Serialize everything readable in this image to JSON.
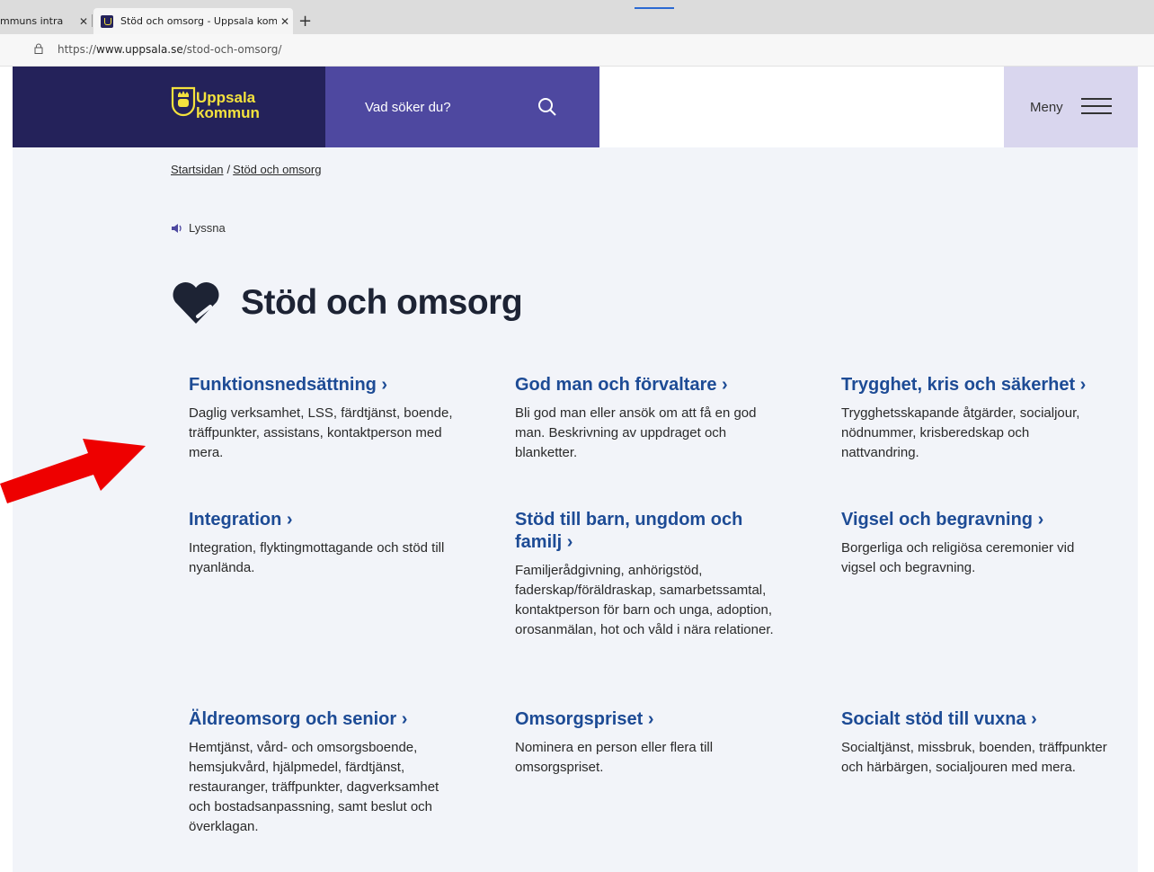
{
  "browser": {
    "tabs": [
      {
        "label": "mmuns intra",
        "active": false
      },
      {
        "label": "Stöd och omsorg - Uppsala kom",
        "active": true
      }
    ],
    "url_prefix": "https://",
    "url_domain": "www.uppsala.se",
    "url_path": "/stod-och-omsorg/"
  },
  "header": {
    "logo_line1": "Uppsala",
    "logo_line2": "kommun",
    "search_placeholder": "Vad söker du?",
    "menu_label": "Meny",
    "brand_color": "#24225a",
    "search_color": "#4e48a0",
    "menu_color": "#d9d6ee",
    "logo_color": "#f4e23d"
  },
  "breadcrumb": {
    "home": "Startsidan",
    "separator": "/",
    "current": "Stöd och omsorg"
  },
  "listen_label": "Lyssna",
  "page_title": "Stöd och omsorg",
  "title_icon": "heart-icon",
  "link_color": "#1d4b95",
  "cards": [
    {
      "title": "Funktionsnedsättning ›",
      "desc": "Daglig verksamhet, LSS, färdtjänst, boende, träffpunkter, assistans, kontaktperson med mera."
    },
    {
      "title": "God man och förvaltare ›",
      "desc": "Bli god man eller ansök om att få en god man. Beskrivning av uppdraget och blanketter."
    },
    {
      "title": "Trygghet, kris och säkerhet ›",
      "desc": "Trygghetsskapande åtgärder, socialjour, nödnummer, krisberedskap och nattvandring."
    },
    {
      "title": "Integration ›",
      "desc": "Integration, flyktingmottagande och stöd till nyanlända."
    },
    {
      "title": "Stöd till barn, ungdom och familj ›",
      "desc": "Familjerådgivning, anhörigstöd, faderskap/föräldraskap, samarbetssamtal, kontaktperson för barn och unga, adoption, orosanmälan, hot och våld i nära relationer."
    },
    {
      "title": "Vigsel och begravning ›",
      "desc": "Borgerliga och religiösa ceremonier vid vigsel och begravning."
    },
    {
      "title": "Äldreomsorg och senior ›",
      "desc": "Hemtjänst, vård- och omsorgsboende, hemsjukvård, hjälpmedel, färdtjänst, restauranger, träffpunkter, dagverksamhet och bostadsanpassning, samt beslut och överklagan."
    },
    {
      "title": "Omsorgspriset ›",
      "desc": "Nominera en person eller flera till omsorgspriset."
    },
    {
      "title": "Socialt stöd till vuxna ›",
      "desc": "Socialtjänst, missbruk, boenden, träffpunkter och härbärgen, socialjouren med mera."
    }
  ],
  "annotation_arrow_color": "#ee0000"
}
